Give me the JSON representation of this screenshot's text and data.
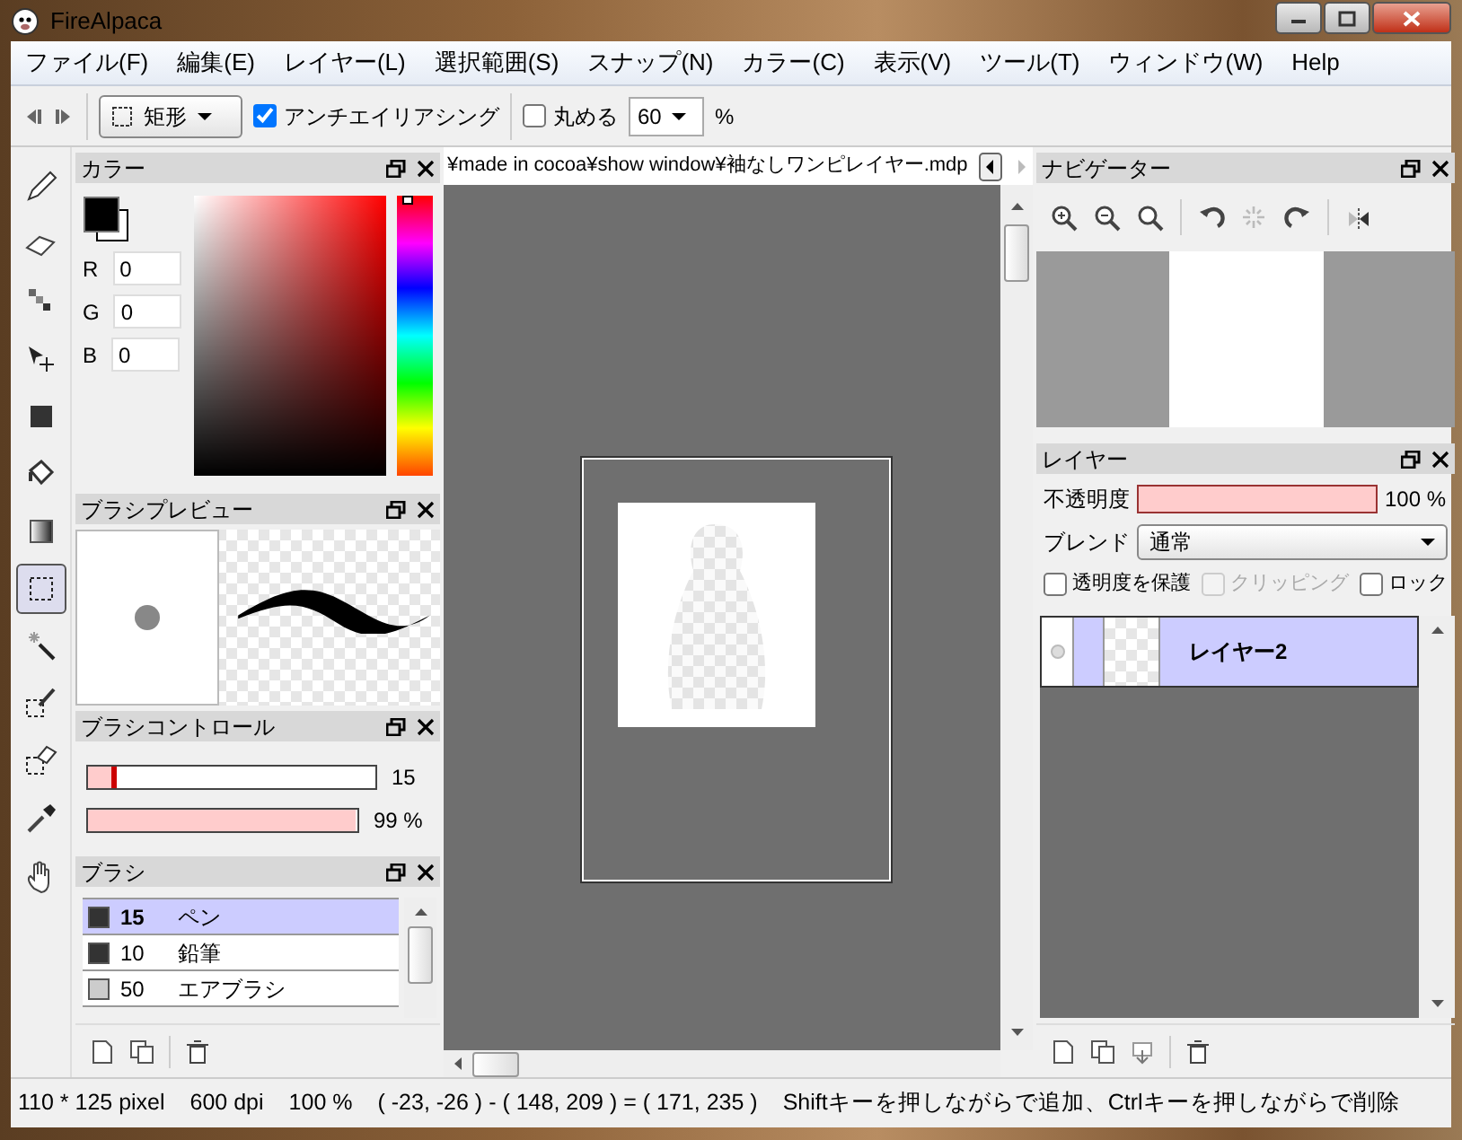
{
  "window": {
    "title": "FireAlpaca"
  },
  "menu": [
    "ファイル(F)",
    "編集(E)",
    "レイヤー(L)",
    "選択範囲(S)",
    "スナップ(N)",
    "カラー(C)",
    "表示(V)",
    "ツール(T)",
    "ウィンドウ(W)",
    "Help"
  ],
  "toolbar": {
    "shape": "矩形",
    "antialias": {
      "label": "アンチエイリアシング",
      "checked": true
    },
    "round": {
      "label": "丸める",
      "checked": false
    },
    "round_value": "60",
    "round_unit": "%"
  },
  "tools": [
    {
      "kind": "pen",
      "selected": false
    },
    {
      "kind": "eraser",
      "selected": false
    },
    {
      "kind": "dot",
      "selected": false
    },
    {
      "kind": "move",
      "selected": false
    },
    {
      "kind": "fill",
      "selected": false
    },
    {
      "kind": "bucket",
      "selected": false
    },
    {
      "kind": "gradient",
      "selected": false
    },
    {
      "kind": "select",
      "selected": true
    },
    {
      "kind": "wand",
      "selected": false
    },
    {
      "kind": "selpen",
      "selected": false
    },
    {
      "kind": "seleraser",
      "selected": false
    },
    {
      "kind": "dropper",
      "selected": false
    },
    {
      "kind": "hand",
      "selected": false
    }
  ],
  "color_panel": {
    "title": "カラー",
    "hue": {
      "level": 0
    },
    "channels": [
      {
        "label": "R",
        "value": "0"
      },
      {
        "label": "G",
        "value": "0"
      },
      {
        "label": "B",
        "value": "0"
      }
    ]
  },
  "brush_preview": {
    "title": "ブラシプレビュー"
  },
  "brush_control": {
    "title": "ブラシコントロール",
    "size": {
      "level": 0.1,
      "reading": "15"
    },
    "opacity": {
      "level": 0.99,
      "reading": "99 %"
    }
  },
  "brushes": {
    "title": "ブラシ",
    "items": [
      {
        "size": "15",
        "name": "ペン",
        "selected": true,
        "color": "#333333"
      },
      {
        "size": "10",
        "name": "鉛筆",
        "selected": false,
        "color": "#333333"
      },
      {
        "size": "50",
        "name": "エアブラシ",
        "selected": false,
        "color": "#cccccc"
      }
    ]
  },
  "document": {
    "tab": "¥made in cocoa¥show window¥袖なしワンピレイヤー.mdp"
  },
  "navigator": {
    "title": "ナビゲーター"
  },
  "layers": {
    "title": "レイヤー",
    "opacity_label": "不透明度",
    "opacity": {
      "level": 1,
      "reading": "100 %"
    },
    "blend_label": "ブレンド",
    "blend": "通常",
    "options": [
      {
        "label": "透明度を保護",
        "checked": false,
        "disabled": false
      },
      {
        "label": "クリッピング",
        "checked": false,
        "disabled": true
      },
      {
        "label": "ロック",
        "checked": false,
        "disabled": false
      }
    ],
    "items": [
      {
        "name": "レイヤー2",
        "selected": true
      }
    ]
  },
  "status_bar": [
    "110 * 125 pixel",
    "600 dpi",
    "100 %",
    "( -23, -26 ) - ( 148, 209 ) = ( 171, 235 )",
    "Shiftキーを押しながらで追加、Ctrlキーを押しながらで削除"
  ]
}
